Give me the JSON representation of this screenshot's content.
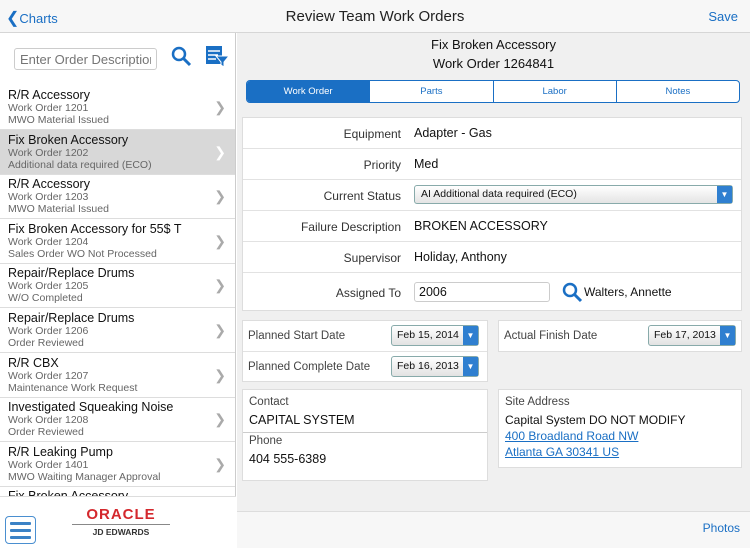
{
  "header": {
    "back_label": "Charts",
    "title": "Review Team Work Orders",
    "save_label": "Save"
  },
  "sidebar": {
    "search_placeholder": "Enter Order Description",
    "items": [
      {
        "title": "R/R Accessory",
        "order": "Work Order 1201",
        "status": "MWO Material Issued"
      },
      {
        "title": "Fix Broken Accessory",
        "order": "Work Order 1202",
        "status": "Additional data required (ECO)",
        "selected": true
      },
      {
        "title": "R/R Accessory",
        "order": "Work Order 1203",
        "status": "MWO Material Issued"
      },
      {
        "title": "Fix Broken Accessory for 55$ T",
        "order": "Work Order 1204",
        "status": "Sales Order WO Not Processed"
      },
      {
        "title": "Repair/Replace Drums",
        "order": "Work Order 1205",
        "status": "W/O Completed"
      },
      {
        "title": "Repair/Replace Drums",
        "order": "Work Order 1206",
        "status": "Order Reviewed"
      },
      {
        "title": "R/R CBX",
        "order": "Work Order 1207",
        "status": "Maintenance Work Request"
      },
      {
        "title": "Investigated Squeaking Noise",
        "order": "Work Order 1208",
        "status": "Order Reviewed"
      },
      {
        "title": "R/R Leaking Pump",
        "order": "Work Order 1401",
        "status": "MWO Waiting Manager Approval"
      },
      {
        "title": "Fix Broken Accessory",
        "order": "",
        "status": ""
      }
    ],
    "logo": {
      "brand": "ORACLE",
      "sub": "JD EDWARDS"
    }
  },
  "detail": {
    "title": "Fix Broken Accessory",
    "subtitle": "Work Order 1264841",
    "tabs": [
      "Work Order",
      "Parts",
      "Labor",
      "Notes"
    ],
    "fields": {
      "equipment_label": "Equipment",
      "equipment": "Adapter - Gas",
      "priority_label": "Priority",
      "priority": "Med",
      "status_label": "Current Status",
      "status": "AI Additional data required (ECO)",
      "failure_label": "Failure Description",
      "failure": "BROKEN ACCESSORY",
      "supervisor_label": "Supervisor",
      "supervisor": "Holiday, Anthony",
      "assigned_label": "Assigned To",
      "assigned": "2006",
      "assigned_name": "Walters, Annette"
    },
    "dates": {
      "planned_start_label": "Planned Start Date",
      "planned_start": "Feb 15, 2014",
      "planned_complete_label": "Planned Complete Date",
      "planned_complete": "Feb 16, 2013",
      "actual_finish_label": "Actual Finish Date",
      "actual_finish": "Feb 17, 2013"
    },
    "contact": {
      "label": "Contact",
      "value": "CAPITAL SYSTEM",
      "phone_label": "Phone",
      "phone": "404 555-6389"
    },
    "site": {
      "label": "Site Address",
      "name": "Capital System DO NOT MODIFY",
      "line1": "400 Broadland Road NW",
      "line2": "Atlanta GA 30341 US"
    }
  },
  "footer": {
    "photos_label": "Photos"
  },
  "colors": {
    "accent": "#1a6fc4",
    "selected_row": "#d8d8d8"
  }
}
